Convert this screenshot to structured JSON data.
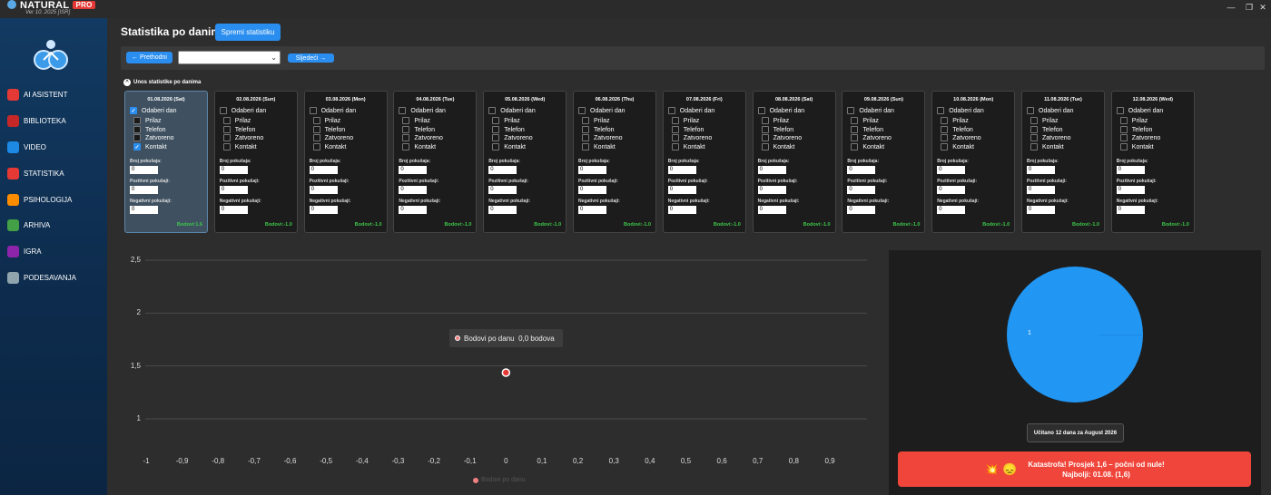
{
  "app": {
    "name": "NATURAL",
    "badge": "PRO",
    "version": "Ver 10. 2025 [ISR]"
  },
  "sidebar": {
    "items": [
      {
        "label": "AI ASISTENT",
        "icon": "robot-icon",
        "color": "#e53935"
      },
      {
        "label": "BIBLIOTEKA",
        "icon": "book-icon",
        "color": "#c62828"
      },
      {
        "label": "VIDEO",
        "icon": "video-icon",
        "color": "#1e88e5"
      },
      {
        "label": "STATISTIKA",
        "icon": "stats-icon",
        "color": "#e53935"
      },
      {
        "label": "PSIHOLOGIJA",
        "icon": "brain-icon",
        "color": "#fb8c00"
      },
      {
        "label": "ARHIVA",
        "icon": "archive-icon",
        "color": "#43a047"
      },
      {
        "label": "IGRA",
        "icon": "game-icon",
        "color": "#8e24aa"
      },
      {
        "label": "PODESAVANJA",
        "icon": "gear-icon",
        "color": "#90a4ae"
      }
    ]
  },
  "header": {
    "title": "Statistika po danima",
    "save_label": "Spremi statistiku"
  },
  "nav": {
    "prev_label": "← Prethodni",
    "next_label": "Sljedeći →",
    "select_value": ""
  },
  "section": {
    "label": "Unos statistike po danima",
    "toggle": "^"
  },
  "labels": {
    "select_day": "Odaberi dan",
    "attempts": "Broj pokušaja:",
    "positive": "Pozitivni pokušaji:",
    "negative": "Negativni pokušaji:"
  },
  "days": [
    {
      "date": "01.08.2026 (Sat)",
      "selected": true,
      "options": [
        {
          "label": "Prilaz",
          "checked": false
        },
        {
          "label": "Telefon",
          "checked": false
        },
        {
          "label": "Zatvoreno",
          "checked": false
        },
        {
          "label": "Kontakt",
          "checked": true
        }
      ],
      "attempts": "0",
      "positive": "0",
      "negative": "0",
      "score": "Bodovi:1.6"
    },
    {
      "date": "02.08.2026 (Sun)",
      "selected": false,
      "options": [
        {
          "label": "Prilaz",
          "checked": false
        },
        {
          "label": "Telefon",
          "checked": false
        },
        {
          "label": "Zatvoreno",
          "checked": false
        },
        {
          "label": "Kontakt",
          "checked": false
        }
      ],
      "attempts": "0",
      "positive": "0",
      "negative": "0",
      "score": "Bodovi:-1.0"
    },
    {
      "date": "03.08.2026 (Mon)",
      "selected": false,
      "options": [
        {
          "label": "Prilaz",
          "checked": false
        },
        {
          "label": "Telefon",
          "checked": false
        },
        {
          "label": "Zatvoreno",
          "checked": false
        },
        {
          "label": "Kontakt",
          "checked": false
        }
      ],
      "attempts": "0",
      "positive": "0",
      "negative": "0",
      "score": "Bodovi:-1.0"
    },
    {
      "date": "04.08.2026 (Tue)",
      "selected": false,
      "options": [
        {
          "label": "Prilaz",
          "checked": false
        },
        {
          "label": "Telefon",
          "checked": false
        },
        {
          "label": "Zatvoreno",
          "checked": false
        },
        {
          "label": "Kontakt",
          "checked": false
        }
      ],
      "attempts": "0",
      "positive": "0",
      "negative": "0",
      "score": "Bodovi:-1.0"
    },
    {
      "date": "05.08.2026 (Wed)",
      "selected": false,
      "options": [
        {
          "label": "Prilaz",
          "checked": false
        },
        {
          "label": "Telefon",
          "checked": false
        },
        {
          "label": "Zatvoreno",
          "checked": false
        },
        {
          "label": "Kontakt",
          "checked": false
        }
      ],
      "attempts": "0",
      "positive": "0",
      "negative": "0",
      "score": "Bodovi:-1.0"
    },
    {
      "date": "06.08.2026 (Thu)",
      "selected": false,
      "options": [
        {
          "label": "Prilaz",
          "checked": false
        },
        {
          "label": "Telefon",
          "checked": false
        },
        {
          "label": "Zatvoreno",
          "checked": false
        },
        {
          "label": "Kontakt",
          "checked": false
        }
      ],
      "attempts": "0",
      "positive": "0",
      "negative": "0",
      "score": "Bodovi:-1.0"
    },
    {
      "date": "07.08.2026 (Fri)",
      "selected": false,
      "options": [
        {
          "label": "Prilaz",
          "checked": false
        },
        {
          "label": "Telefon",
          "checked": false
        },
        {
          "label": "Zatvoreno",
          "checked": false
        },
        {
          "label": "Kontakt",
          "checked": false
        }
      ],
      "attempts": "0",
      "positive": "0",
      "negative": "0",
      "score": "Bodovi:-1.0"
    },
    {
      "date": "08.08.2026 (Sat)",
      "selected": false,
      "options": [
        {
          "label": "Prilaz",
          "checked": false
        },
        {
          "label": "Telefon",
          "checked": false
        },
        {
          "label": "Zatvoreno",
          "checked": false
        },
        {
          "label": "Kontakt",
          "checked": false
        }
      ],
      "attempts": "0",
      "positive": "0",
      "negative": "0",
      "score": "Bodovi:-1.0"
    },
    {
      "date": "09.08.2026 (Sun)",
      "selected": false,
      "options": [
        {
          "label": "Prilaz",
          "checked": false
        },
        {
          "label": "Telefon",
          "checked": false
        },
        {
          "label": "Zatvoreno",
          "checked": false
        },
        {
          "label": "Kontakt",
          "checked": false
        }
      ],
      "attempts": "0",
      "positive": "0",
      "negative": "0",
      "score": "Bodovi:-1.0"
    },
    {
      "date": "10.08.2026 (Mon)",
      "selected": false,
      "options": [
        {
          "label": "Prilaz",
          "checked": false
        },
        {
          "label": "Telefon",
          "checked": false
        },
        {
          "label": "Zatvoreno",
          "checked": false
        },
        {
          "label": "Kontakt",
          "checked": false
        }
      ],
      "attempts": "0",
      "positive": "0",
      "negative": "0",
      "score": "Bodovi:-1.0"
    },
    {
      "date": "11.08.2026 (Tue)",
      "selected": false,
      "options": [
        {
          "label": "Prilaz",
          "checked": false
        },
        {
          "label": "Telefon",
          "checked": false
        },
        {
          "label": "Zatvoreno",
          "checked": false
        },
        {
          "label": "Kontakt",
          "checked": false
        }
      ],
      "attempts": "0",
      "positive": "0",
      "negative": "0",
      "score": "Bodovi:-1.0"
    },
    {
      "date": "12.08.2026 (Wed)",
      "selected": false,
      "options": [
        {
          "label": "Prilaz",
          "checked": false
        },
        {
          "label": "Telefon",
          "checked": false
        },
        {
          "label": "Zatvoreno",
          "checked": false
        },
        {
          "label": "Kontakt",
          "checked": false
        }
      ],
      "attempts": "0",
      "positive": "0",
      "negative": "0",
      "score": "Bodovi:-1.0"
    }
  ],
  "chart_data": {
    "type": "scatter",
    "series": [
      {
        "name": "Bodovi po danu",
        "points": [
          {
            "x": 0,
            "y": 1.6
          }
        ],
        "color": "#f08080"
      }
    ],
    "xlim": [
      -1,
      0.9
    ],
    "ylim": [
      1,
      2.5
    ],
    "x_ticks": [
      "-1",
      "-0,9",
      "-0,8",
      "-0,7",
      "-0,6",
      "-0,5",
      "-0,4",
      "-0,3",
      "-0,2",
      "-0,1",
      "0",
      "0,1",
      "0,2",
      "0,3",
      "0,4",
      "0,5",
      "0,6",
      "0,7",
      "0,8",
      "0,9"
    ],
    "y_ticks": [
      "2,5",
      "2",
      "1,5",
      "1"
    ],
    "tooltip": {
      "series": "Bodovi po danu",
      "value": "0,0 bodova"
    },
    "legend": "Bodovi po danu",
    "grid": true
  },
  "pie": {
    "slices": [
      {
        "label": "1",
        "value": 1,
        "color": "#2196f3"
      }
    ]
  },
  "summary": {
    "loaded": "Učitano 12 dana za August 2026"
  },
  "alert": {
    "line1": "Katastrofa! Prosjek 1,6 – počni od nule!",
    "line2": "Najbolji: 01.08. (1,6)",
    "icons": "💥 😞",
    "color": "#f0453a"
  }
}
